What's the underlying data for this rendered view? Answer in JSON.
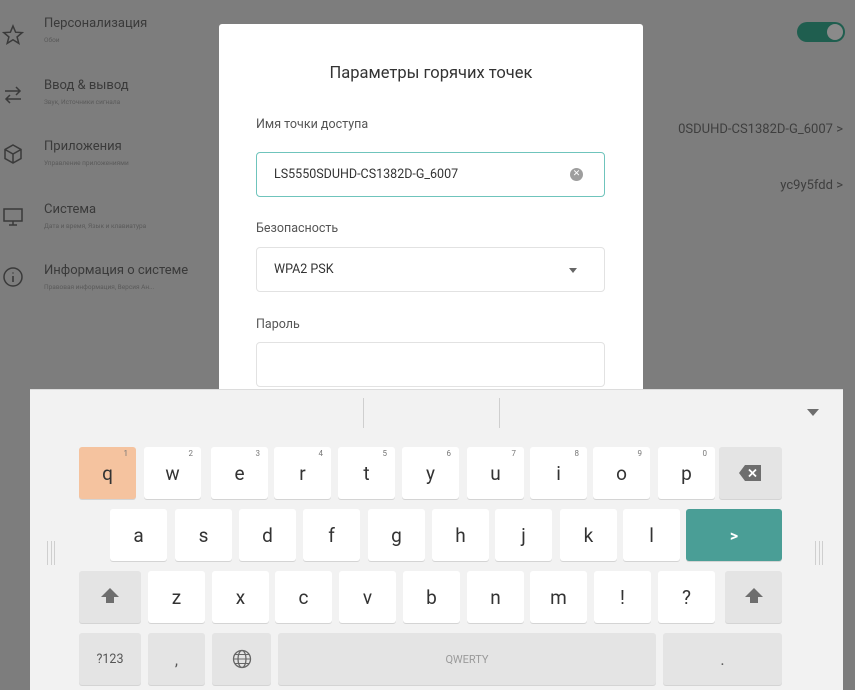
{
  "sidebar": {
    "items": [
      {
        "title": "Персонализация",
        "subtitle": "Обои",
        "icon": "star-icon"
      },
      {
        "title": "Ввод & вывод",
        "subtitle": "Звук, Источники сигнала",
        "icon": "swap-arrows-icon"
      },
      {
        "title": "Приложения",
        "subtitle": "Управление приложениями",
        "icon": "apps-cube-icon"
      },
      {
        "title": "Система",
        "subtitle": "Дата и время, Язык и клавиатура",
        "icon": "monitor-icon"
      },
      {
        "title": "Информация о системе",
        "subtitle": "Правовая информация, Версия Ан...",
        "icon": "info-icon"
      }
    ]
  },
  "right_panel": {
    "row1": "0SDUHD-CS1382D-G_6007 >",
    "row2": "yc9y5fdd >"
  },
  "dialog": {
    "title": "Параметры горячих точек",
    "ssid_label": "Имя точки доступа",
    "ssid_value": "LS5550SDUHD-CS1382D-G_6007",
    "security_label": "Безопасность",
    "security_value": "WPA2 PSK",
    "password_label": "Пароль",
    "password_value": ""
  },
  "keyboard": {
    "row1": [
      {
        "k": "q",
        "h": "1"
      },
      {
        "k": "w",
        "h": "2"
      },
      {
        "k": "e",
        "h": "3"
      },
      {
        "k": "r",
        "h": "4"
      },
      {
        "k": "t",
        "h": "5"
      },
      {
        "k": "y",
        "h": "6"
      },
      {
        "k": "u",
        "h": "7"
      },
      {
        "k": "i",
        "h": "8"
      },
      {
        "k": "o",
        "h": "9"
      },
      {
        "k": "p",
        "h": "0"
      }
    ],
    "row2": [
      "a",
      "s",
      "d",
      "f",
      "g",
      "h",
      "j",
      "k",
      "l"
    ],
    "enter_label": ">",
    "row3": [
      "z",
      "x",
      "c",
      "v",
      "b",
      "n",
      "m",
      "!",
      "?"
    ],
    "symbols_label": "?123",
    "comma_label": ",",
    "space_label": "QWERTY",
    "period_label": ".",
    "accent_color": "#4a9e96",
    "pressed_color": "#f5c39f"
  }
}
